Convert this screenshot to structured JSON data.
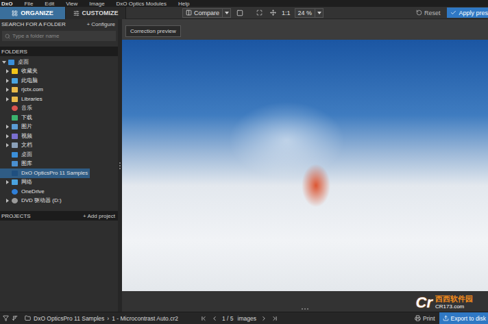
{
  "app": {
    "logo": "DxO"
  },
  "menu": [
    "File",
    "Edit",
    "View",
    "Image",
    "DxO Optics Modules",
    "Help"
  ],
  "modes": [
    {
      "label": "ORGANIZE",
      "selected": true
    },
    {
      "label": "CUSTOMIZE",
      "selected": false
    }
  ],
  "toolbar": {
    "compare": "Compare",
    "one_to_one": "1:1",
    "zoom": "24 %",
    "reset": "Reset",
    "apply": "Apply pres"
  },
  "sidebar": {
    "search": {
      "title": "SEARCH FOR A FOLDER",
      "action": "+ Configure",
      "placeholder": "Type a folder name"
    },
    "folders": {
      "title": "FOLDERS",
      "items": [
        {
          "label": "桌面",
          "depth": 0,
          "has_children": true,
          "expanded": true,
          "selected": false,
          "kind": "desktop"
        },
        {
          "label": "收藏夹",
          "depth": 1,
          "has_children": true,
          "expanded": false,
          "selected": false,
          "kind": "star"
        },
        {
          "label": "此电脑",
          "depth": 1,
          "has_children": true,
          "expanded": false,
          "selected": false,
          "kind": "pc"
        },
        {
          "label": "rjctx.com",
          "depth": 1,
          "has_children": true,
          "expanded": false,
          "selected": false,
          "kind": "folder"
        },
        {
          "label": "Libraries",
          "depth": 1,
          "has_children": true,
          "expanded": false,
          "selected": false,
          "kind": "folder"
        },
        {
          "label": "音乐",
          "depth": 1,
          "has_children": false,
          "expanded": false,
          "selected": false,
          "kind": "music"
        },
        {
          "label": "下载",
          "depth": 1,
          "has_children": false,
          "expanded": false,
          "selected": false,
          "kind": "download"
        },
        {
          "label": "图片",
          "depth": 1,
          "has_children": true,
          "expanded": false,
          "selected": false,
          "kind": "picture"
        },
        {
          "label": "视频",
          "depth": 1,
          "has_children": true,
          "expanded": false,
          "selected": false,
          "kind": "video"
        },
        {
          "label": "文档",
          "depth": 1,
          "has_children": true,
          "expanded": false,
          "selected": false,
          "kind": "doc"
        },
        {
          "label": "桌面",
          "depth": 1,
          "has_children": false,
          "expanded": false,
          "selected": false,
          "kind": "desktop"
        },
        {
          "label": "图库",
          "depth": 1,
          "has_children": false,
          "expanded": false,
          "selected": false,
          "kind": "gallery"
        },
        {
          "label": "DxO OpticsPro 11 Samples",
          "depth": 1,
          "has_children": false,
          "expanded": false,
          "selected": true,
          "kind": "dxo"
        },
        {
          "label": "网络",
          "depth": 1,
          "has_children": true,
          "expanded": false,
          "selected": false,
          "kind": "network"
        },
        {
          "label": "OneDrive",
          "depth": 1,
          "has_children": false,
          "expanded": false,
          "selected": false,
          "kind": "cloud"
        },
        {
          "label": "DVD 驱动器 (D:)",
          "depth": 1,
          "has_children": true,
          "expanded": false,
          "selected": false,
          "kind": "disc"
        }
      ]
    },
    "projects": {
      "title": "PROJECTS",
      "action": "+ Add project"
    }
  },
  "preview": {
    "label": "Correction preview"
  },
  "status_bar": {
    "path": "DxO OpticsPro 11 Samples",
    "separator": "›",
    "file": "1 - Microcontrast Auto.cr2",
    "counter": "1 / 5",
    "counter_unit": "images",
    "print": "Print",
    "export": "Export to disk"
  },
  "watermark": {
    "logo": "Cr",
    "site": "西西软件园",
    "url": "CR173.com"
  }
}
